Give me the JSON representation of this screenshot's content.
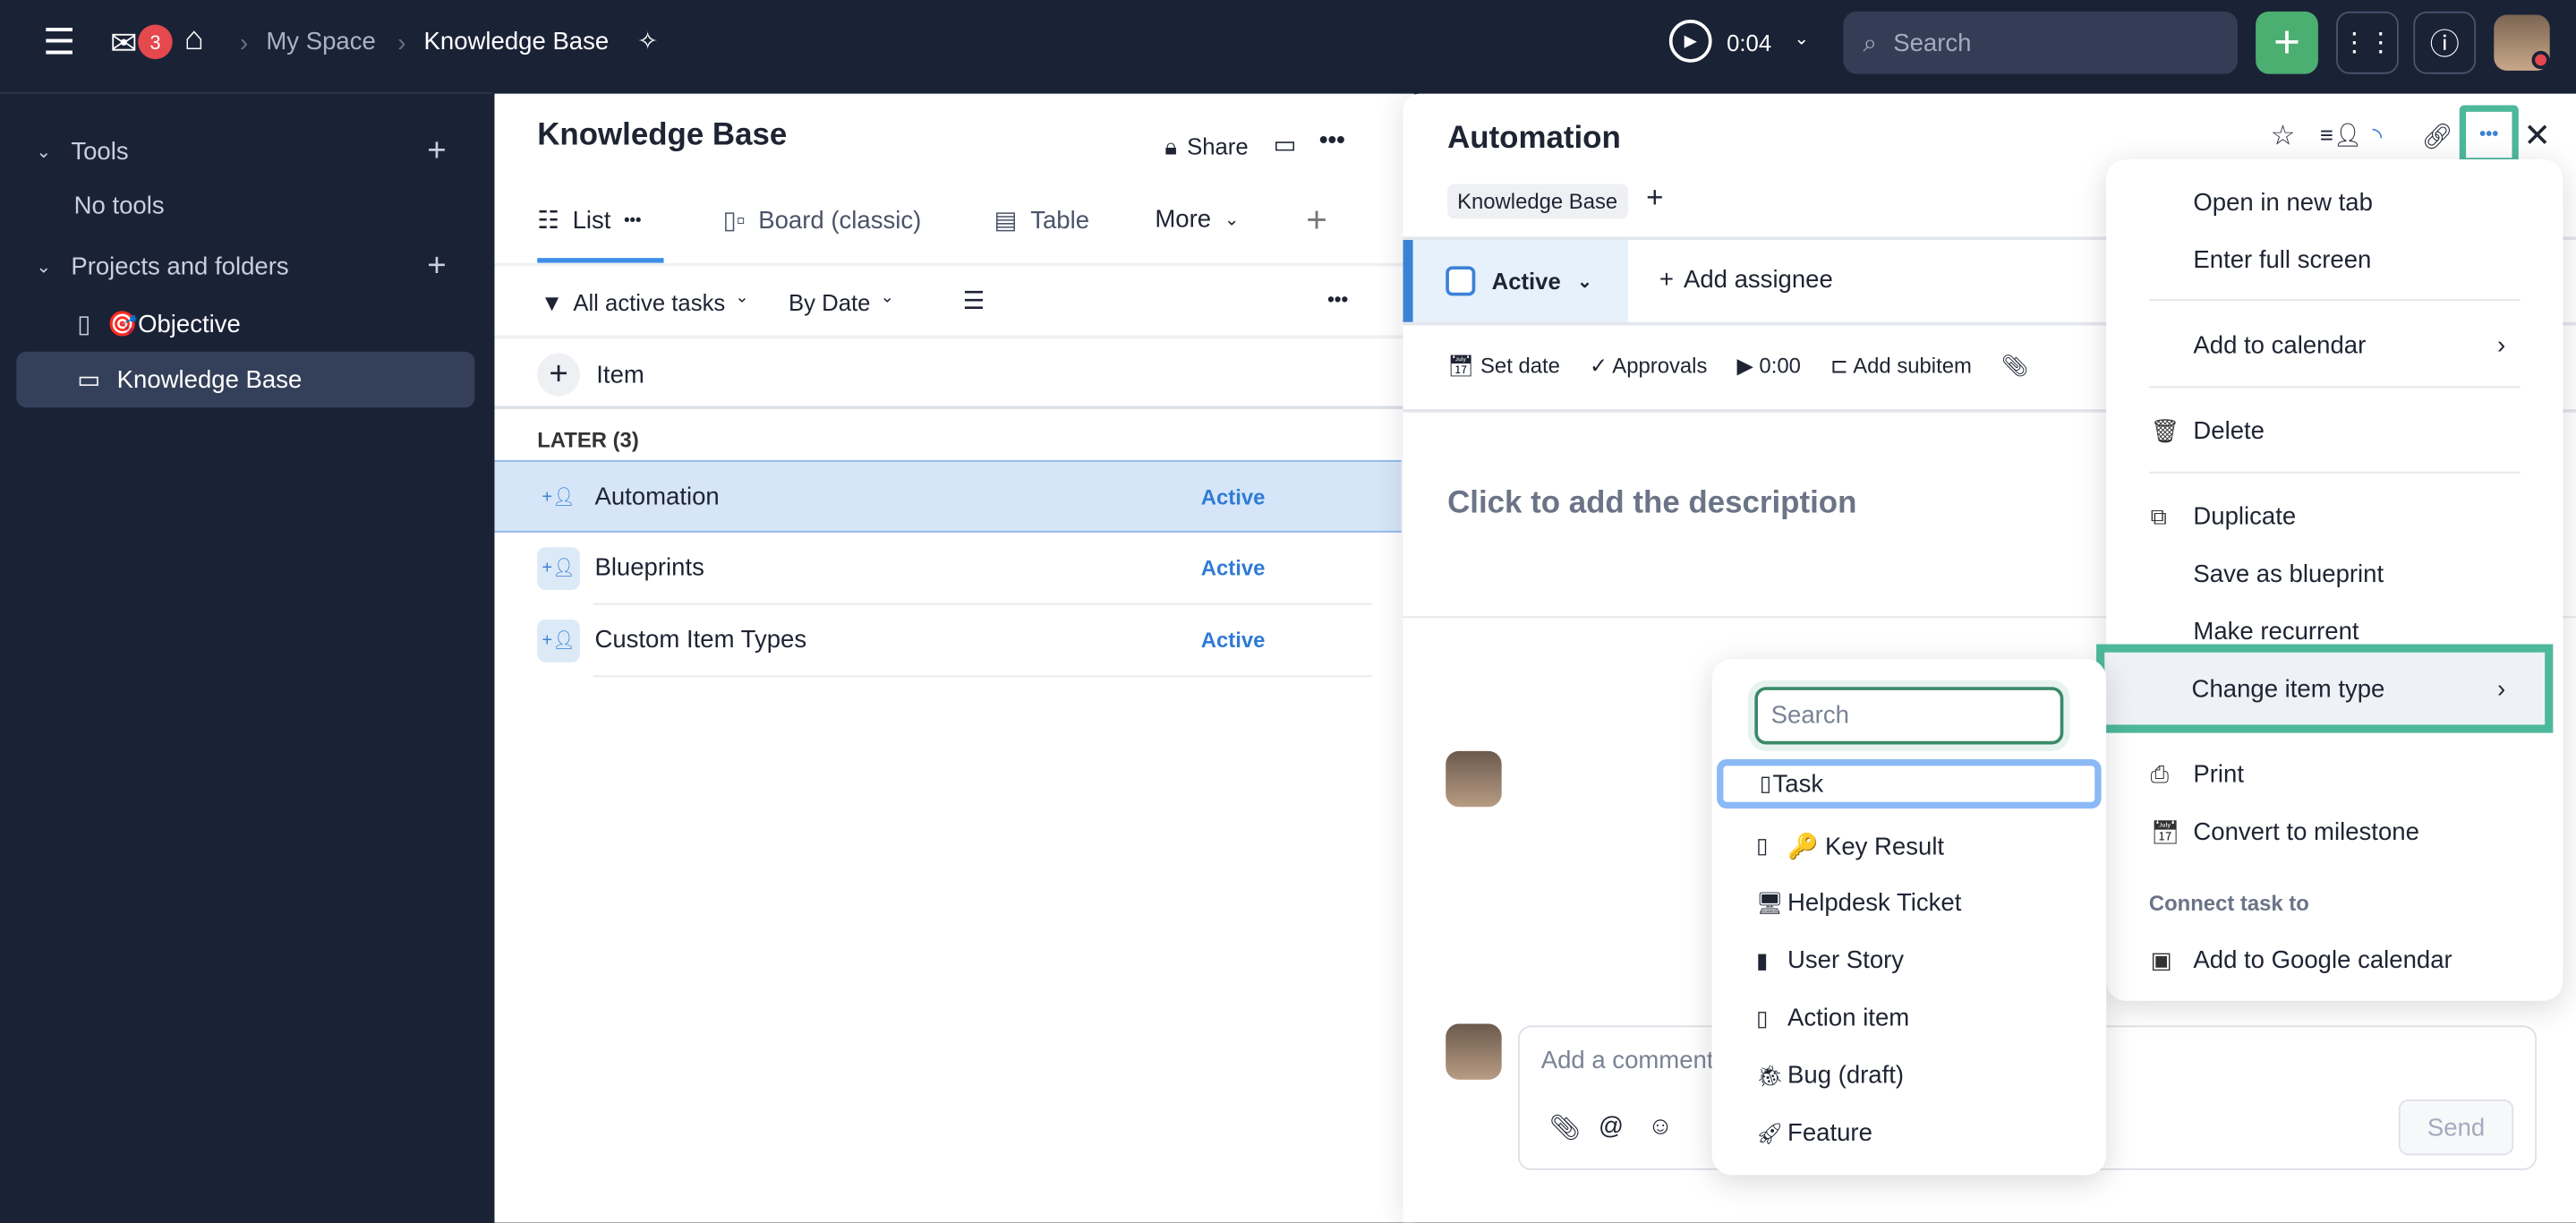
{
  "topbar": {
    "mail_badge": "3",
    "breadcrumb": [
      "My Space",
      "Knowledge Base"
    ],
    "timer": "0:04",
    "search_placeholder": "Search",
    "accent": "#4caf72"
  },
  "sidebar": {
    "tools_label": "Tools",
    "no_tools": "No tools",
    "projects_label": "Projects and folders",
    "items": [
      {
        "label": "🎯Objective"
      },
      {
        "label": "Knowledge Base"
      }
    ]
  },
  "main": {
    "title": "Knowledge Base",
    "share": "Share",
    "tabs": [
      {
        "label": "List"
      },
      {
        "label": "Board (classic)"
      },
      {
        "label": "Table"
      },
      {
        "label": "More"
      }
    ],
    "filter": "All active tasks",
    "sort": "By Date",
    "add_item": "Item",
    "group": "LATER (3)",
    "rows": [
      {
        "title": "Automation",
        "status": "Active"
      },
      {
        "title": "Blueprints",
        "status": "Active"
      },
      {
        "title": "Custom Item Types",
        "status": "Active"
      }
    ]
  },
  "detail": {
    "title": "Automation",
    "tag": "Knowledge Base",
    "status": "Active",
    "add_assignee": "Add assignee",
    "set_date": "Set date",
    "approvals": "Approvals",
    "time": "0:00",
    "add_subitem": "Add subitem",
    "description_placeholder": "Click to add the description",
    "comment_placeholder": "Add a comment",
    "send": "Send"
  },
  "menu": {
    "items": [
      "Open in new tab",
      "Enter full screen",
      "Add to calendar",
      "Delete",
      "Duplicate",
      "Save as blueprint",
      "Make recurrent",
      "Change item type",
      "Print",
      "Convert to milestone"
    ],
    "section": "Connect task to",
    "google": "Add to Google calendar",
    "highlight": "#4db89b"
  },
  "submenu": {
    "search_placeholder": "Search",
    "items": [
      "Task",
      "🔑 Key Result",
      "Helpdesk Ticket",
      "User Story",
      "Action item",
      "Bug (draft)",
      "Feature"
    ]
  }
}
